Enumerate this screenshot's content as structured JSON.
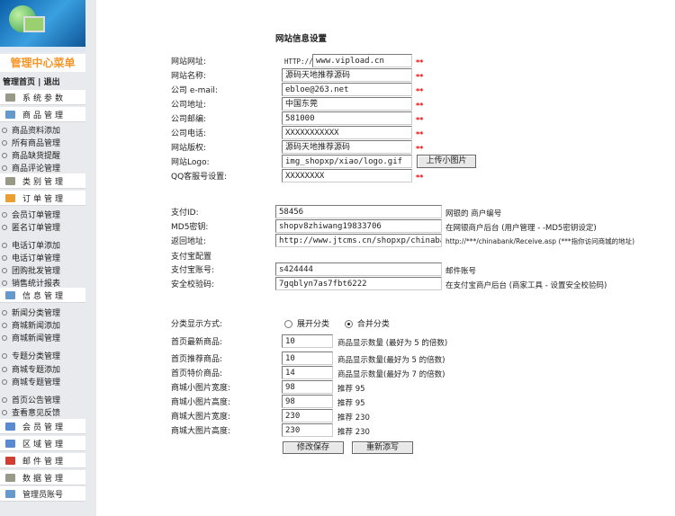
{
  "sidebar": {
    "menu_title": "管理中心菜单",
    "home_link": "管理首页",
    "logout_link": "退出",
    "sections": [
      {
        "label": "系统参数",
        "items": []
      },
      {
        "label": "商品管理",
        "items": [
          "商品资料添加",
          "所有商品管理",
          "商品缺货提醒",
          "商品评论管理"
        ]
      },
      {
        "label": "类别管理",
        "items": []
      },
      {
        "label": "订单管理",
        "items": [
          "会员订单管理",
          "匿名订单管理",
          "电话订单添加",
          "电话订单管理",
          "团购批发管理",
          "销售统计报表"
        ]
      },
      {
        "label": "信息管理",
        "items": [
          "新闻分类管理",
          "商城新闻添加",
          "商城新闻管理",
          "专题分类管理",
          "商城专题添加",
          "商城专题管理",
          "首页公告管理",
          "查看意见反馈"
        ]
      },
      {
        "label": "会员管理",
        "items": []
      },
      {
        "label": "区域管理",
        "items": []
      },
      {
        "label": "邮件管理",
        "items": []
      },
      {
        "label": "数据管理",
        "items": []
      },
      {
        "label": "管理员账号",
        "items": []
      }
    ]
  },
  "form": {
    "title": "网站信息设置",
    "http_prefix": "HTTP://",
    "required_mark": "**",
    "site": [
      {
        "label": "网站网址:",
        "value": "www.vipload.cn"
      },
      {
        "label": "网站名称:",
        "value": "源码天地推荐源码"
      },
      {
        "label": "公司 e-mail:",
        "value": "ebloe@263.net"
      },
      {
        "label": "公司地址:",
        "value": "中国东莞"
      },
      {
        "label": "公司邮编:",
        "value": "581000"
      },
      {
        "label": "公司电话:",
        "value": "XXXXXXXXXXX"
      },
      {
        "label": "网站版权:",
        "value": "源码天地推荐源码"
      },
      {
        "label": "网站Logo:",
        "value": "img_shopxp/xiao/logo.gif"
      },
      {
        "label": "QQ客服号设置:",
        "value": "XXXXXXXX"
      }
    ],
    "upload_button": "上传小图片",
    "payment": [
      {
        "label": "支付ID:",
        "value": "58456",
        "note": "网银的 商户编号"
      },
      {
        "label": "MD5密钥:",
        "value": "shopv8zhiwang19833706",
        "note": "在网银商户后台 (用户管理 - -MD5密钥设定)"
      },
      {
        "label": "返回地址:",
        "value": "http://www.jtcms.cn/shopxp/chinabank/",
        "note": "http://***/chinabank/Receive.asp (***指你访问商城的地址)"
      }
    ],
    "alipay_heading": "支付宝配置",
    "alipay": [
      {
        "label": "支付宝账号:",
        "value": "s424444",
        "note": "邮件账号"
      },
      {
        "label": "安全校验码:",
        "value": "7gqblyn7as7fbt6222",
        "note": "在支付宝商户后台 (商家工具 - 设置安全校验码)"
      }
    ],
    "category_display": {
      "label": "分类显示方式:",
      "options": [
        "展开分类",
        "合并分类"
      ],
      "selected": "合并分类"
    },
    "display": [
      {
        "label": "首页最新商品:",
        "value": "10",
        "note": "商品显示数量 (最好为 5 的倍数)"
      },
      {
        "label": "首页推荐商品:",
        "value": "10",
        "note": "商品显示数量(最好为 5 的倍数)"
      },
      {
        "label": "首页特价商品:",
        "value": "14",
        "note": "商品显示数量(最好为 7 的倍数)"
      },
      {
        "label": "商城小图片宽度:",
        "value": "98",
        "note": "推荐 95"
      },
      {
        "label": "商城小图片高度:",
        "value": "98",
        "note": "推荐 95"
      },
      {
        "label": "商城大图片宽度:",
        "value": "230",
        "note": "推荐 230"
      },
      {
        "label": "商城大图片高度:",
        "value": "230",
        "note": "推荐 230"
      }
    ],
    "save_button": "修改保存",
    "reset_button": "重新添写"
  }
}
